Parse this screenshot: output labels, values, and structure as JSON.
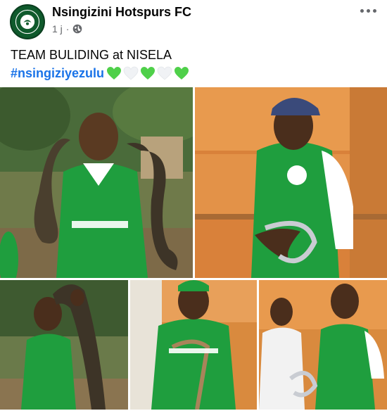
{
  "post": {
    "page_name": "Nsingizini Hotspurs FC",
    "timestamp": "1 j",
    "separator": "·",
    "privacy_icon": "globe-icon",
    "menu_icon": "more-options-icon",
    "text": "TEAM BULIDING at NISELA",
    "hashtag": "#nsingiziyezulu",
    "emojis": [
      "green-heart",
      "white-heart",
      "green-heart",
      "white-heart",
      "green-heart"
    ]
  },
  "colors": {
    "hashtag": "#1a73e8",
    "green_heart": "#4fd04a",
    "white_heart": "#f0f2f5",
    "jersey_green": "#1f9e3e",
    "meta_gray": "#65676b"
  },
  "photos": [
    {
      "subject": "man in green jersey holding large python"
    },
    {
      "subject": "man in cap holding small snake in reptile house"
    },
    {
      "subject": "man lifting python by head"
    },
    {
      "subject": "man holding snake in front of terrariums"
    },
    {
      "subject": "two men, one holding snake"
    }
  ]
}
